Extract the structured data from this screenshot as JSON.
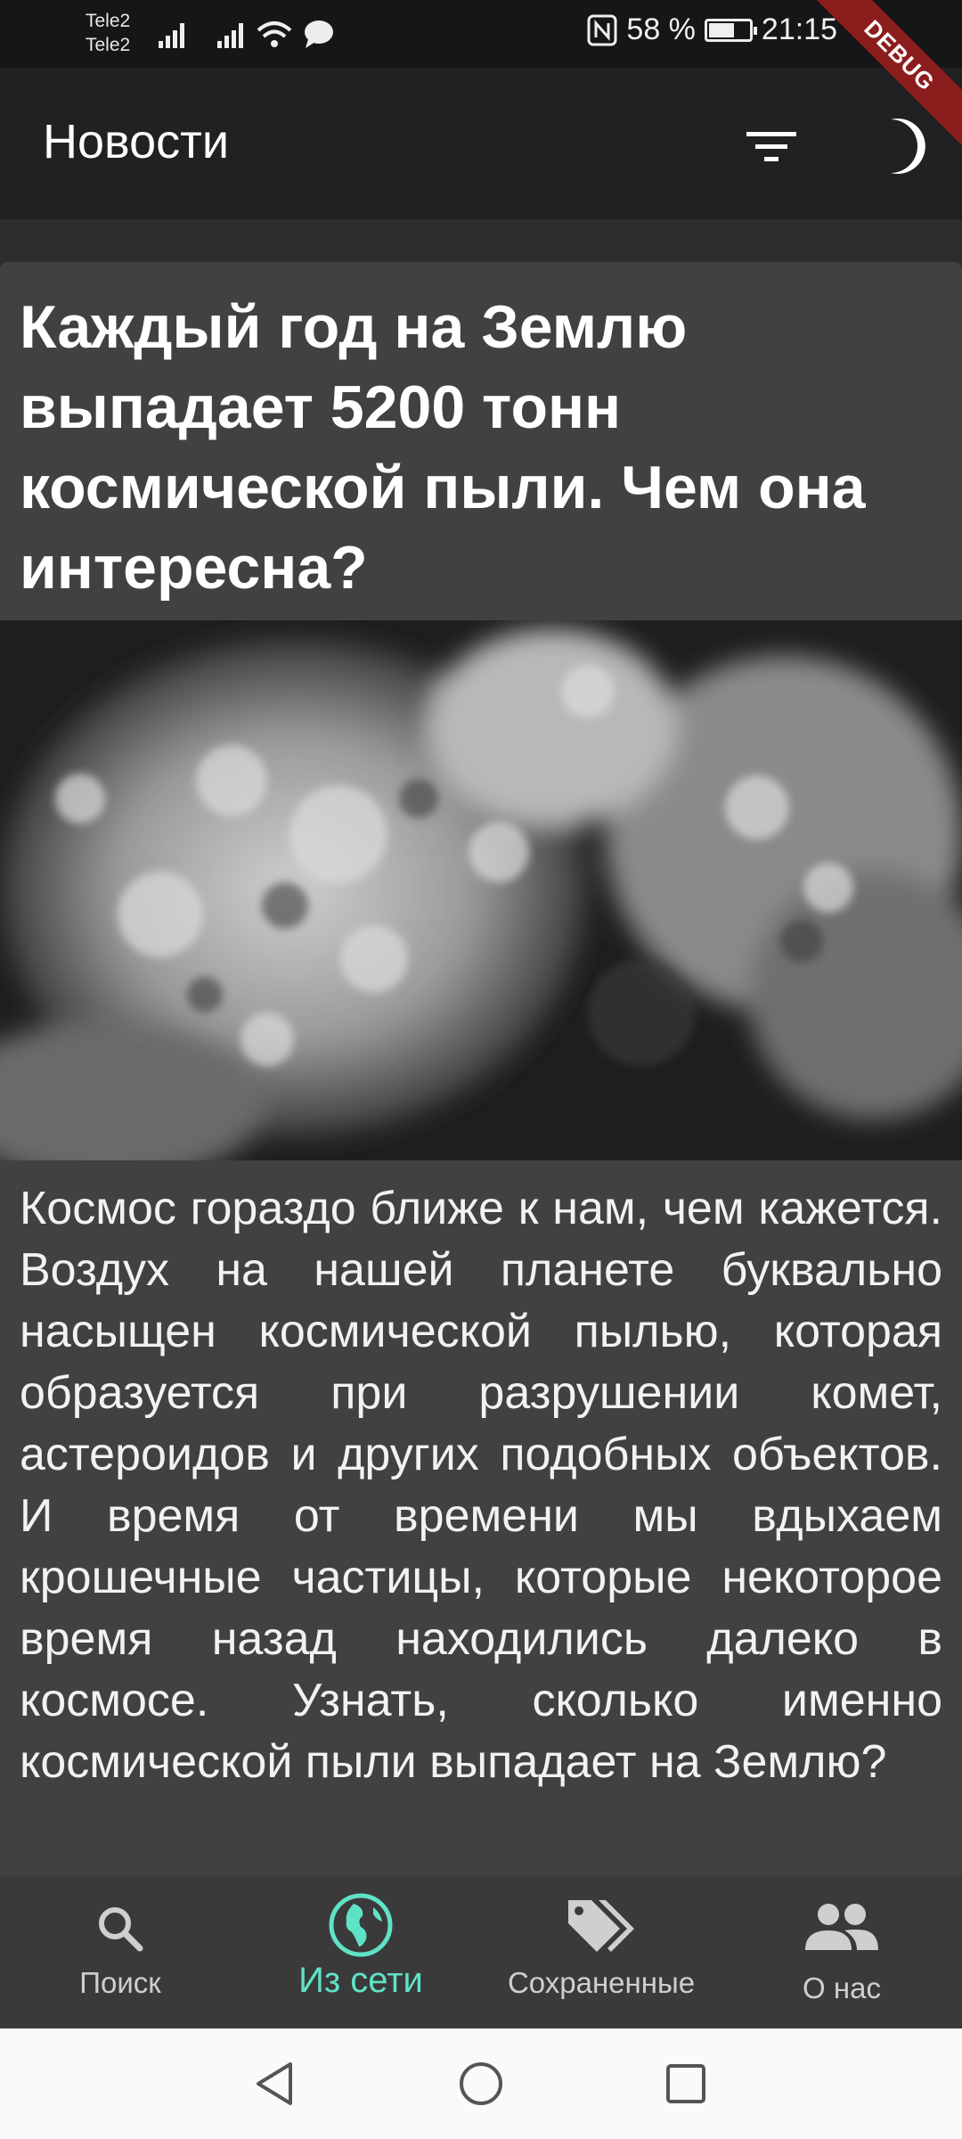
{
  "status_bar": {
    "carrier_1": "Tele2",
    "carrier_2": "Tele2",
    "battery": "58 %",
    "battery_level": 0.58,
    "time": "21:15",
    "debug_banner": "DEBUG"
  },
  "appbar": {
    "title": "Новости",
    "icons": [
      "filter-icon",
      "moon-icon"
    ]
  },
  "article": {
    "title": "Каждый год на Землю выпадает 5200 тонн космической пыли. Чем она интересна?",
    "body": "Космос гораздо ближе к нам, чем кажется. Воздух на нашей планете буквально насыщен космической пылью, которая образуется при разрушении комет, астероидов и других подобных объектов. И время от времени мы вдыхаем крошечные частицы, которые некоторое время назад находились далеко в космосе. Узнать, сколько именно космической пыли выпадает на Землю?"
  },
  "bottom_nav": {
    "items": [
      {
        "label": "Поиск",
        "icon": "search-icon",
        "active": false
      },
      {
        "label": "Из сети",
        "icon": "globe-icon",
        "active": true
      },
      {
        "label": "Сохраненные",
        "icon": "tags-icon",
        "active": false
      },
      {
        "label": "О нас",
        "icon": "people-icon",
        "active": false
      }
    ]
  },
  "colors": {
    "accent": "#5fe3c6",
    "appbar": "#212121",
    "card": "#414141",
    "bottom_nav": "#3a3a3a"
  }
}
